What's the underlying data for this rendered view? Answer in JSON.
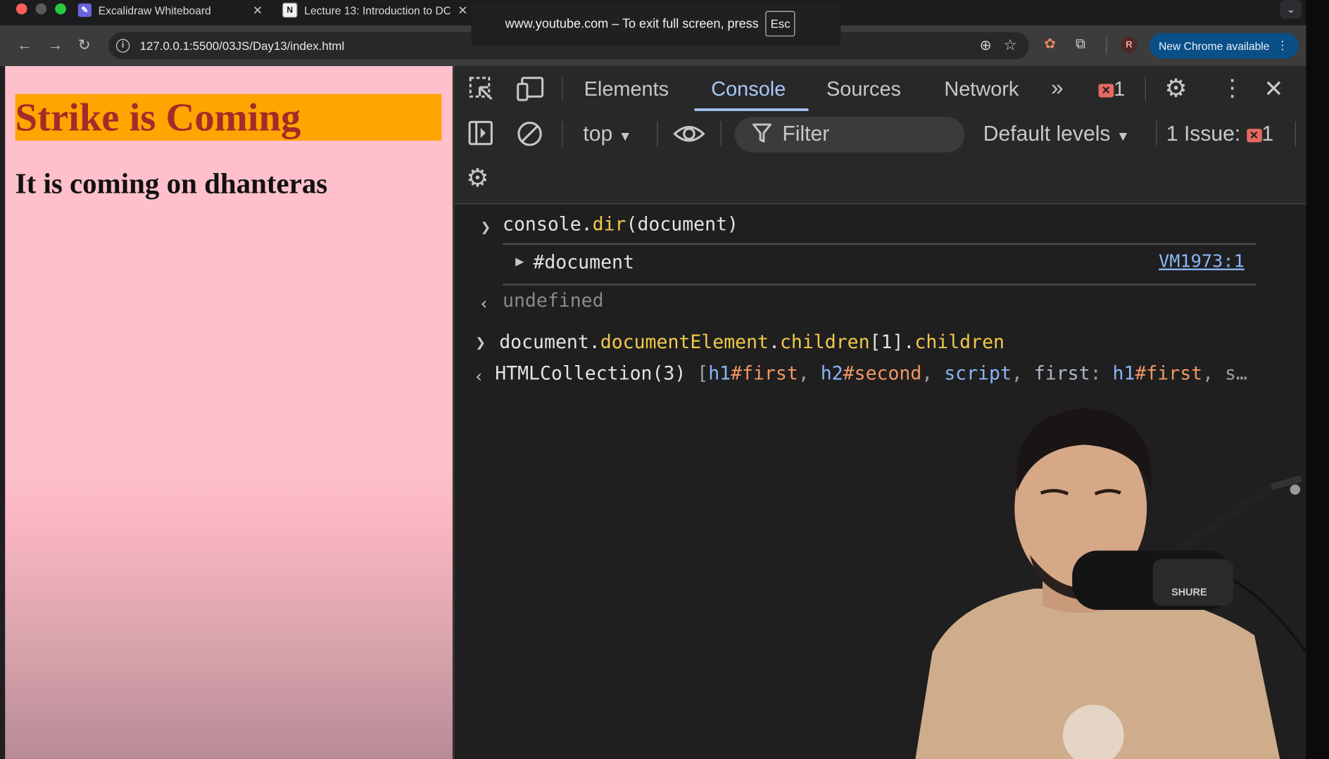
{
  "browser": {
    "tabs": [
      {
        "title": "Excalidraw Whiteboard",
        "favicon": "excalidraw-icon"
      },
      {
        "title": "Lecture 13: Introduction to DO",
        "favicon": "notion-icon"
      }
    ],
    "url": "127.0.0.1:5500/03JS/Day13/index.html",
    "new_chrome_label": "New Chrome available",
    "avatar_letter": "R"
  },
  "fullscreen_banner": {
    "text": "www.youtube.com – To exit full screen, press",
    "key": "Esc"
  },
  "page": {
    "h1": "Strike is Coming",
    "h2": "It is coming on dhanteras",
    "colors": {
      "background": "#ffc0cb",
      "h1_background": "#ffa500",
      "h1_text": "#a52a2a"
    }
  },
  "devtools": {
    "tabs": [
      "Elements",
      "Console",
      "Sources",
      "Network"
    ],
    "active_tab": "Console",
    "error_count": "1",
    "context": "top",
    "filter_placeholder": "Filter",
    "levels": "Default levels",
    "issues_label": "1 Issue:",
    "issues_count": "1",
    "console": {
      "cmd1": {
        "obj": "console",
        "method": "dir",
        "arg": "(document)"
      },
      "result1": "#document",
      "result1_source": "VM1973:1",
      "undefined_text": "undefined",
      "cmd2": {
        "obj": "document",
        "prop1": "documentElement",
        "prop2": "children",
        "index": "[1]",
        "prop3": "children"
      },
      "result2": {
        "type": "HTMLCollection(3)",
        "items": [
          "h1",
          "#first",
          "h2",
          "#second",
          "script"
        ],
        "key": "first",
        "key_value_tag": "h1",
        "key_value_id": "#first",
        "tail": "s…"
      }
    }
  }
}
